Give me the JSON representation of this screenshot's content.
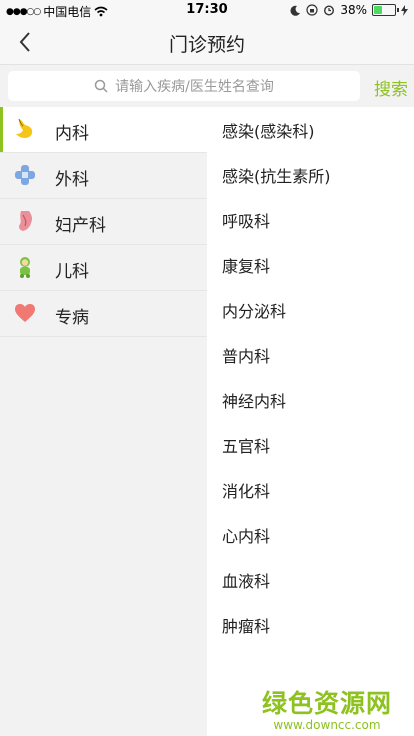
{
  "status_bar": {
    "carrier": "中国电信",
    "time": "17:30",
    "battery": "38%",
    "battery_level": 0.38,
    "signal_icon": "signal-dots-icon",
    "wifi_icon": "wifi-icon"
  },
  "nav": {
    "title": "门诊预约",
    "back_icon": "chevron-left-icon"
  },
  "search": {
    "placeholder": "请输入疾病/医生姓名查询",
    "button": "搜索"
  },
  "departments": [
    {
      "label": "内科",
      "icon": "stomach-icon",
      "active": true
    },
    {
      "label": "外科",
      "icon": "bandage-icon",
      "active": false
    },
    {
      "label": "妇产科",
      "icon": "uterus-icon",
      "active": false
    },
    {
      "label": "儿科",
      "icon": "baby-icon",
      "active": false
    },
    {
      "label": "专病",
      "icon": "heart-icon",
      "active": false
    }
  ],
  "subdepartments": [
    "感染(感染科)",
    "感染(抗生素所)",
    "呼吸科",
    "康复科",
    "内分泌科",
    "普内科",
    "神经内科",
    "五官科",
    "消化科",
    "心内科",
    "血液科",
    "肿瘤科"
  ],
  "watermark": {
    "title": "绿色资源网",
    "url": "www.downcc.com"
  },
  "colors": {
    "accent": "#8dc21f",
    "panel_bg": "#f2f2f2"
  }
}
